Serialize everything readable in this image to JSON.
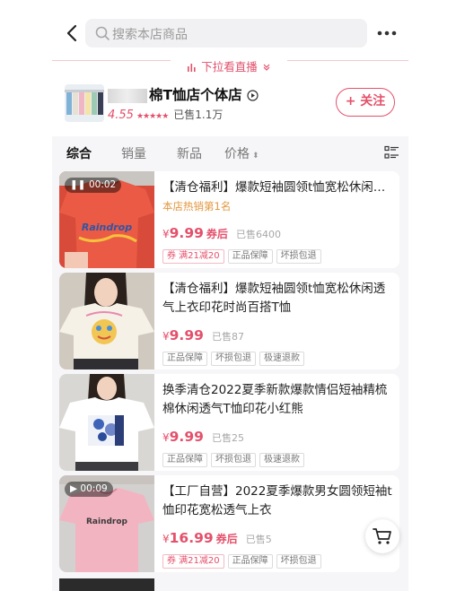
{
  "search": {
    "placeholder": "搜索本店商品"
  },
  "pull_live": {
    "label": "下拉看直播"
  },
  "store": {
    "name": "棉T恤店个体店",
    "score": "4.55",
    "stars": "★★★★★",
    "sold": "已售1.1万",
    "follow_label": "+ 关注"
  },
  "filters": {
    "tabs": [
      "综合",
      "销量",
      "新品",
      "价格"
    ],
    "sort_glyph": "⬍"
  },
  "products": [
    {
      "video_time": "00:02",
      "title": "【清仓福利】爆款短袖圆领t恤宽松休闲透气上衣",
      "rank": "本店热销第1名",
      "price_symbol": "¥",
      "price": "9.99",
      "price_suffix": "券后",
      "sold": "已售6400",
      "tags": [
        "券 满21减20",
        "正品保障",
        "坏损包退"
      ]
    },
    {
      "title": "【清仓福利】爆款短袖圆领t恤宽松休闲透气上衣印花时尚百搭T恤",
      "price_symbol": "¥",
      "price": "9.99",
      "sold": "已售87",
      "tags": [
        "正品保障",
        "坏损包退",
        "极速退款"
      ]
    },
    {
      "title": "换季清仓2022夏季新款爆款情侣短袖精梳棉休闲透气T恤印花小红熊",
      "price_symbol": "¥",
      "price": "9.99",
      "sold": "已售25",
      "tags": [
        "正品保障",
        "坏损包退",
        "极速退款"
      ]
    },
    {
      "video_time": "00:09",
      "title": "【工厂自营】2022夏季爆款男女圆领短袖t恤印花宽松透气上衣",
      "price_symbol": "¥",
      "price": "16.99",
      "price_suffix": "券后",
      "sold": "已售5",
      "tags": [
        "券 满21减20",
        "正品保障",
        "坏损包退"
      ]
    }
  ],
  "shirt_prints": {
    "p1": "Raindrop",
    "p4": "Raindrop"
  },
  "colors": {
    "accent": "#e4506b",
    "rank": "#e2973f",
    "shirt_red": "#e8543f",
    "shirt_pink": "#f2b3bf"
  },
  "icons": [
    "back-arrow-icon",
    "search-icon",
    "more-dots-icon",
    "bar-chart-icon",
    "chevron-down-double-icon",
    "play-circle-icon",
    "sort-arrows-icon",
    "list-grid-icon",
    "pause-icon",
    "play-icon",
    "cart-icon"
  ]
}
